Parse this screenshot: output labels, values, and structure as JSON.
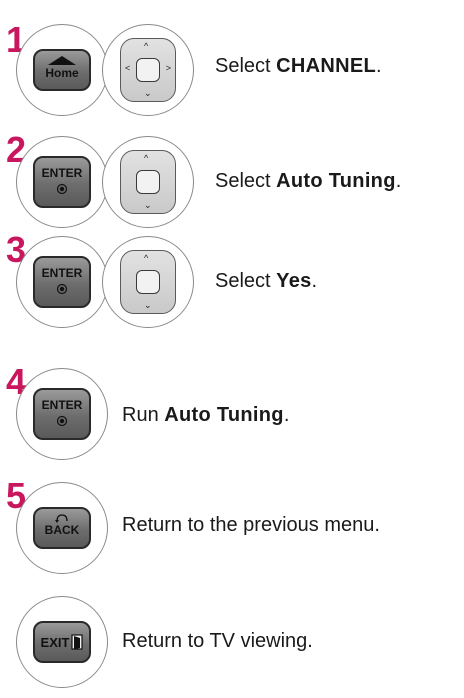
{
  "accent_color": "#c8175e",
  "steps": [
    {
      "number": "1",
      "buttons": [
        "home-button",
        "dpad-4way"
      ],
      "button_label": "Home",
      "text_prefix": "Select ",
      "text_bold": "CHANNEL",
      "text_suffix": "."
    },
    {
      "number": "2",
      "buttons": [
        "enter-button",
        "dpad-updown"
      ],
      "button_label": "ENTER",
      "text_prefix": "Select ",
      "text_bold": "Auto Tuning",
      "text_suffix": "."
    },
    {
      "number": "3",
      "buttons": [
        "enter-button",
        "dpad-updown"
      ],
      "button_label": "ENTER",
      "text_prefix": "Select ",
      "text_bold": "Yes",
      "text_suffix": "."
    },
    {
      "number": "4",
      "buttons": [
        "enter-button"
      ],
      "button_label": "ENTER",
      "text_prefix": "Run ",
      "text_bold": "Auto Tuning",
      "text_suffix": "."
    },
    {
      "number": "5",
      "buttons": [
        "back-button"
      ],
      "button_label": "BACK",
      "text": "Return to the previous menu."
    },
    {
      "number": "",
      "buttons": [
        "exit-button"
      ],
      "button_label": "EXIT",
      "text": "Return to TV viewing."
    }
  ]
}
